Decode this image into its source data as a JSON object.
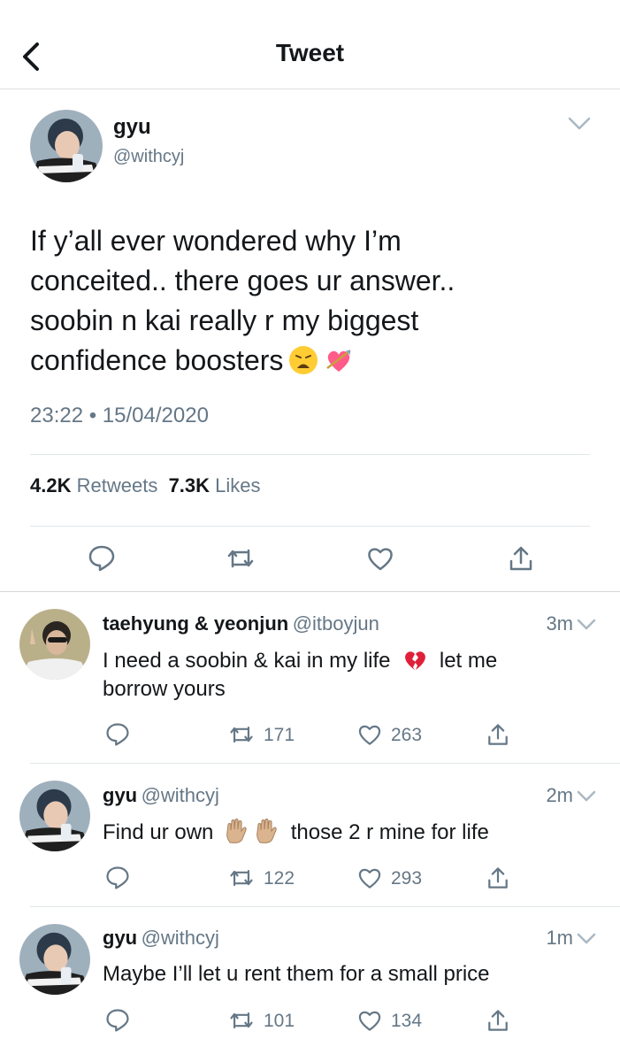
{
  "header": {
    "title": "Tweet"
  },
  "tweet": {
    "name": "gyu",
    "handle": "@withcyj",
    "text_line1": "If y’all ever wondered why I’m",
    "text_line2": "conceited.. there goes ur answer..",
    "text_line3": "soobin n kai really r my biggest",
    "text_line4": "confidence boosters",
    "emojis": [
      "weary-face-emoji",
      "heart-with-arrow-emoji"
    ],
    "timestamp": "23:22 • 15/04/2020",
    "retweets_count": "4.2K",
    "retweets_label": "Retweets",
    "likes_count": "7.3K",
    "likes_label": "Likes"
  },
  "replies": [
    {
      "name": "taehyung & yeonjun",
      "handle": "@itboyjun",
      "time": "3m",
      "text_a": "I need a soobin & kai in my life",
      "emoji": "broken-heart-emoji",
      "text_b": "let me",
      "text_c": "borrow yours",
      "retweets": "171",
      "likes": "263"
    },
    {
      "name": "gyu",
      "handle": "@withcyj",
      "time": "2m",
      "text_a": "Find ur own",
      "emoji": "raised-hand-emoji",
      "text_b": "those 2 r mine for life",
      "retweets": "122",
      "likes": "293"
    },
    {
      "name": "gyu",
      "handle": "@withcyj",
      "time": "1m",
      "text_a": "Maybe I’ll let u rent them for a small price",
      "retweets": "101",
      "likes": "134"
    }
  ],
  "colors": {
    "text": "#14171a",
    "secondary": "#657786",
    "divider": "#e1e6ea"
  }
}
